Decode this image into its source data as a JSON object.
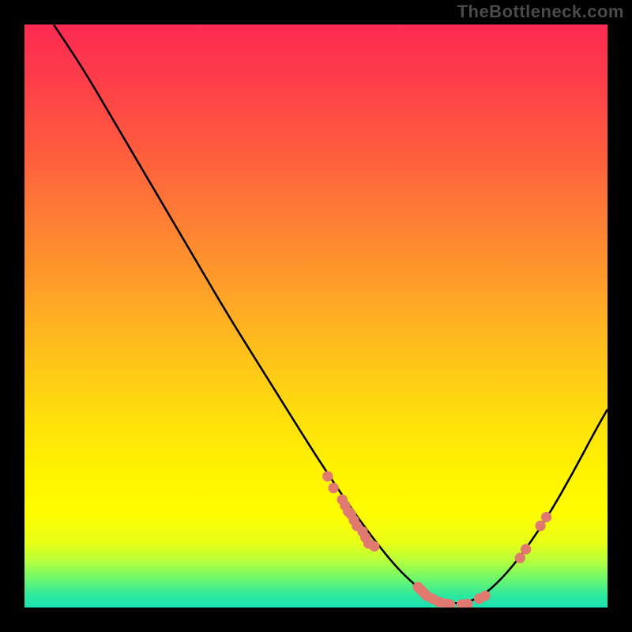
{
  "watermark": "TheBottleneck.com",
  "chart_data": {
    "type": "line",
    "title": "",
    "xlabel": "",
    "ylabel": "",
    "xlim": [
      0,
      100
    ],
    "ylim": [
      0,
      100
    ],
    "curve": [
      {
        "x": 5.0,
        "y": 100.0
      },
      {
        "x": 10.0,
        "y": 92.5
      },
      {
        "x": 15.0,
        "y": 84.0
      },
      {
        "x": 20.0,
        "y": 75.5
      },
      {
        "x": 25.0,
        "y": 67.0
      },
      {
        "x": 30.0,
        "y": 58.5
      },
      {
        "x": 35.0,
        "y": 50.0
      },
      {
        "x": 40.0,
        "y": 42.0
      },
      {
        "x": 45.0,
        "y": 34.0
      },
      {
        "x": 50.0,
        "y": 26.0
      },
      {
        "x": 55.0,
        "y": 18.5
      },
      {
        "x": 60.0,
        "y": 11.5
      },
      {
        "x": 65.0,
        "y": 5.5
      },
      {
        "x": 70.0,
        "y": 1.5
      },
      {
        "x": 74.0,
        "y": 0.5
      },
      {
        "x": 78.0,
        "y": 1.5
      },
      {
        "x": 82.0,
        "y": 5.0
      },
      {
        "x": 86.0,
        "y": 10.0
      },
      {
        "x": 90.0,
        "y": 16.0
      },
      {
        "x": 94.0,
        "y": 23.0
      },
      {
        "x": 98.0,
        "y": 30.5
      },
      {
        "x": 100.0,
        "y": 34.0
      }
    ],
    "points_on_curve": [
      {
        "x": 52.0,
        "y": 22.5
      },
      {
        "x": 53.0,
        "y": 20.5
      },
      {
        "x": 54.5,
        "y": 18.5
      },
      {
        "x": 55.0,
        "y": 17.5
      },
      {
        "x": 55.5,
        "y": 16.5
      },
      {
        "x": 56.0,
        "y": 16.0
      },
      {
        "x": 56.5,
        "y": 15.0
      },
      {
        "x": 57.0,
        "y": 14.0
      },
      {
        "x": 58.0,
        "y": 13.0
      },
      {
        "x": 58.5,
        "y": 12.0
      },
      {
        "x": 59.0,
        "y": 11.0
      },
      {
        "x": 60.0,
        "y": 10.5
      },
      {
        "x": 67.5,
        "y": 3.5
      },
      {
        "x": 68.0,
        "y": 3.0
      },
      {
        "x": 68.5,
        "y": 2.5
      },
      {
        "x": 69.0,
        "y": 2.0
      },
      {
        "x": 70.0,
        "y": 1.5
      },
      {
        "x": 71.0,
        "y": 1.0
      },
      {
        "x": 72.0,
        "y": 0.7
      },
      {
        "x": 72.5,
        "y": 0.6
      },
      {
        "x": 73.0,
        "y": 0.5
      },
      {
        "x": 75.0,
        "y": 0.5
      },
      {
        "x": 76.0,
        "y": 0.6
      },
      {
        "x": 78.0,
        "y": 1.5
      },
      {
        "x": 79.0,
        "y": 2.0
      },
      {
        "x": 85.0,
        "y": 8.5
      },
      {
        "x": 86.0,
        "y": 10.0
      },
      {
        "x": 88.5,
        "y": 14.0
      },
      {
        "x": 89.5,
        "y": 15.5
      }
    ],
    "gradient_stops": [
      {
        "pos": 0.0,
        "color": "#fd2b52"
      },
      {
        "pos": 0.08,
        "color": "#fd3a4b"
      },
      {
        "pos": 0.22,
        "color": "#fe5d3e"
      },
      {
        "pos": 0.38,
        "color": "#fe8b30"
      },
      {
        "pos": 0.52,
        "color": "#feb421"
      },
      {
        "pos": 0.65,
        "color": "#ffd910"
      },
      {
        "pos": 0.76,
        "color": "#fff200"
      },
      {
        "pos": 0.84,
        "color": "#fffd00"
      },
      {
        "pos": 0.89,
        "color": "#e7ff18"
      },
      {
        "pos": 0.92,
        "color": "#b6ff3c"
      },
      {
        "pos": 0.95,
        "color": "#70f86b"
      },
      {
        "pos": 0.98,
        "color": "#2be8a0"
      },
      {
        "pos": 1.0,
        "color": "#1ce2b3"
      }
    ],
    "point_color": "#e0796f",
    "curve_color": "#000000"
  }
}
